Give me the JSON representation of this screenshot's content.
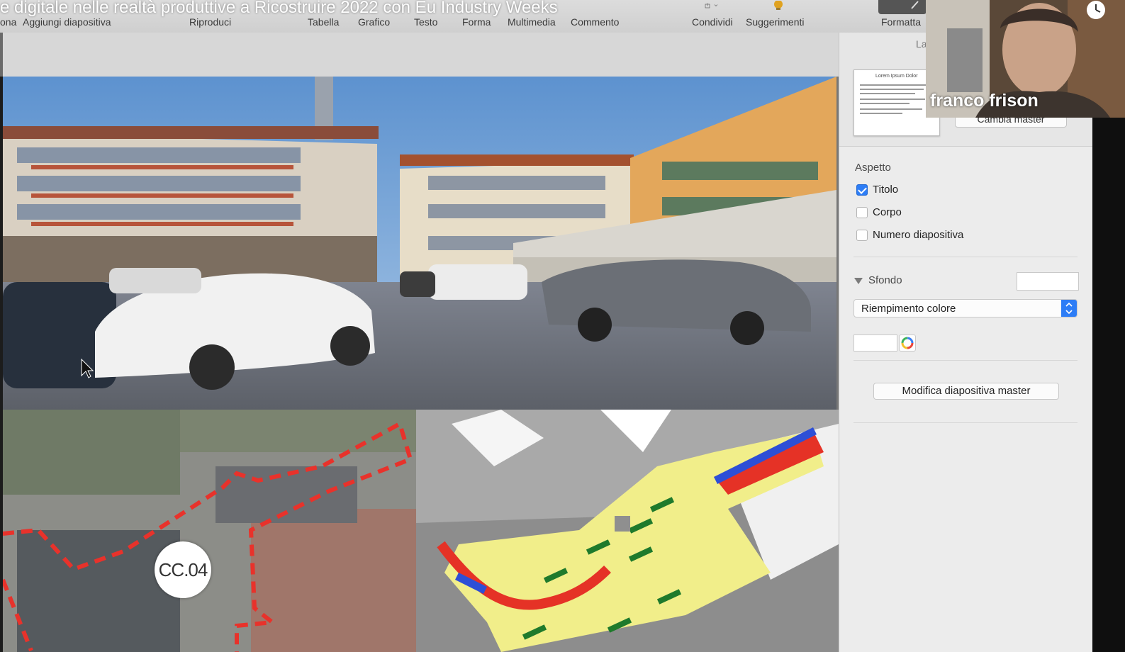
{
  "window": {
    "title": "e digitale nelle realtà produttive a Ricostruire 2022 con Eu Industry Weeks"
  },
  "toolbar": {
    "items": [
      "ona",
      "Aggiungi diapositiva",
      "Riproduci",
      "Tabella",
      "Grafico",
      "Testo",
      "Forma",
      "Multimedia",
      "Commento",
      "Condividi",
      "Suggerimenti",
      "Formatta"
    ],
    "icons": [
      "share-icon",
      "lightbulb-icon",
      "format-brush-icon"
    ]
  },
  "slide": {
    "map_label": "CC.04",
    "colors": {
      "boundary": "#e8322b",
      "plaza": "#f1ee8a",
      "bike_lane": "#e53226",
      "lane_blue": "#2d4fd6",
      "trees": "#1f7a2c"
    }
  },
  "inspector": {
    "tab_label": "La",
    "master_thumbnail_title": "Lorem Ipsum Dolor",
    "change_master_label": "Cambia master",
    "appearance": {
      "heading": "Aspetto",
      "options": [
        {
          "label": "Titolo",
          "checked": true
        },
        {
          "label": "Corpo",
          "checked": false
        },
        {
          "label": "Numero diapositiva",
          "checked": false
        }
      ]
    },
    "background": {
      "heading": "Sfondo",
      "fill_type": "Riempimento colore",
      "color": "#ffffff"
    },
    "edit_master_label": "Modifica diapositiva master",
    "accent_color": "#2d7df6"
  },
  "video": {
    "participant_name": "franco frison"
  }
}
